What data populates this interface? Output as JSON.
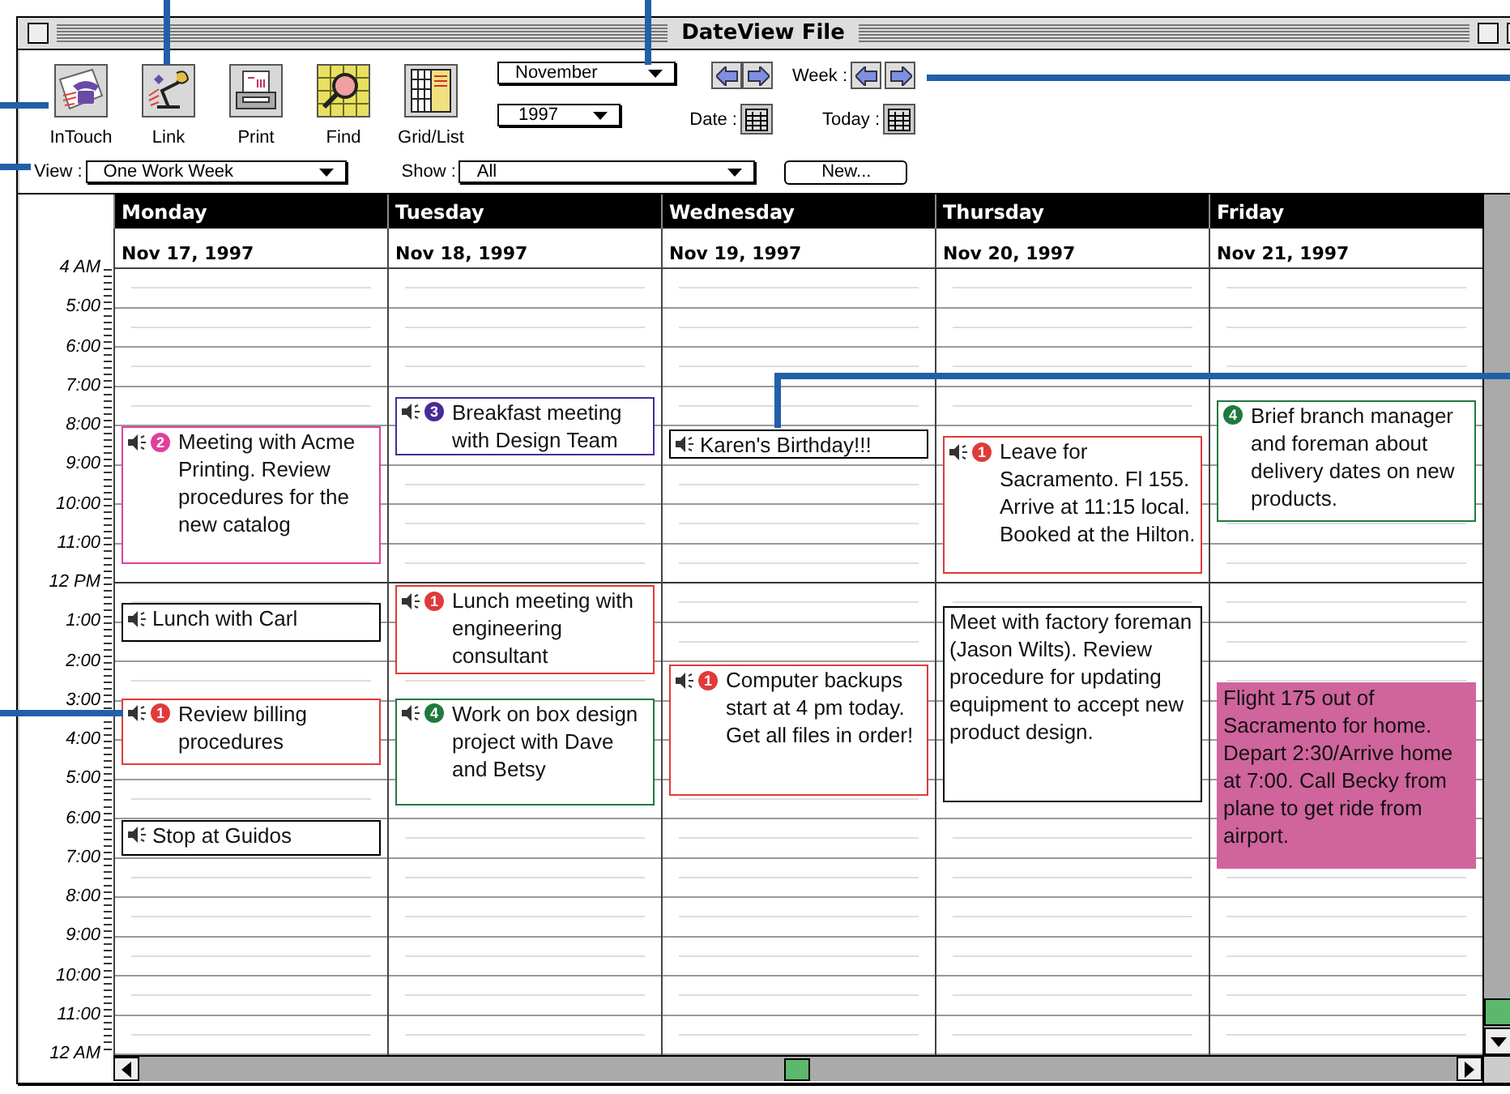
{
  "window": {
    "title": "DateView File"
  },
  "toolbar": {
    "tools": [
      {
        "label": "InTouch",
        "kind": "phone"
      },
      {
        "label": "Link",
        "kind": "link"
      },
      {
        "label": "Print",
        "kind": "print"
      },
      {
        "label": "Find",
        "kind": "find"
      },
      {
        "label": "Grid/List",
        "kind": "gridlist"
      }
    ],
    "month": "November",
    "year": "1997",
    "date_label": "Date :",
    "week_label": "Week :",
    "today_label": "Today :",
    "view": {
      "label": "View :",
      "value": "One Work Week"
    },
    "show": {
      "label": "Show :",
      "value": "All"
    },
    "new_button": "New..."
  },
  "times": [
    "4 AM",
    "5:00",
    "6:00",
    "7:00",
    "8:00",
    "9:00",
    "10:00",
    "11:00",
    "12 PM",
    "1:00",
    "2:00",
    "3:00",
    "4:00",
    "5:00",
    "6:00",
    "7:00",
    "8:00",
    "9:00",
    "10:00",
    "11:00",
    "12 AM"
  ],
  "days": [
    {
      "name": "Monday",
      "date": "Nov 17, 1997",
      "events": [
        {
          "text": "Meeting with Acme Printing. Review procedures for the new catalog",
          "alarm": true,
          "priority": "2",
          "color": "#e0409a",
          "filled": false
        },
        {
          "text": "Lunch with Carl",
          "alarm": true,
          "color": "#000000",
          "filled": false
        },
        {
          "text": "Review billing procedures",
          "alarm": true,
          "priority": "1",
          "color": "#e03a3a",
          "filled": false
        },
        {
          "text": "Stop at Guidos",
          "alarm": true,
          "color": "#000000",
          "filled": false
        }
      ]
    },
    {
      "name": "Tuesday",
      "date": "Nov 18, 1997",
      "events": [
        {
          "text": "Breakfast meeting with Design Team",
          "alarm": true,
          "priority": "3",
          "color": "#4a2a96",
          "filled": false
        },
        {
          "text": "Lunch meeting with engineering consultant",
          "alarm": true,
          "priority": "1",
          "color": "#e03a3a",
          "filled": false
        },
        {
          "text": "Work on box design project with Dave and Betsy",
          "alarm": true,
          "priority": "4",
          "color": "#1f7a3e",
          "filled": false
        }
      ]
    },
    {
      "name": "Wednesday",
      "date": "Nov 19, 1997",
      "events": [
        {
          "text": "Karen's Birthday!!!",
          "alarm": true,
          "color": "#000000",
          "filled": false
        },
        {
          "text": "Computer backups start at 4 pm today. Get all files in order!",
          "alarm": true,
          "priority": "1",
          "color": "#e03a3a",
          "filled": false
        }
      ]
    },
    {
      "name": "Thursday",
      "date": "Nov 20, 1997",
      "events": [
        {
          "text": "Leave for Sacramento. Fl 155. Arrive at 11:15 local. Booked at the Hilton.",
          "alarm": true,
          "priority": "1",
          "color": "#e03a3a",
          "filled": false
        },
        {
          "text": "Meet with factory foreman (Jason Wilts). Review procedure for updating equipment to accept new product design.",
          "alarm": false,
          "color": "#000000",
          "filled": false
        }
      ]
    },
    {
      "name": "Friday",
      "date": "Nov 21, 1997",
      "events": [
        {
          "text": "Brief branch manager and foreman about delivery dates on new products.",
          "alarm": false,
          "priority": "4",
          "color": "#1f7a3e",
          "filled": false
        },
        {
          "text": "Flight 175 out of Sacramento for home. Depart 2:30/Arrive home at 7:00. Call Becky from plane to get ride from airport.",
          "alarm": false,
          "color": "#d0649c",
          "filled": true
        }
      ]
    }
  ]
}
